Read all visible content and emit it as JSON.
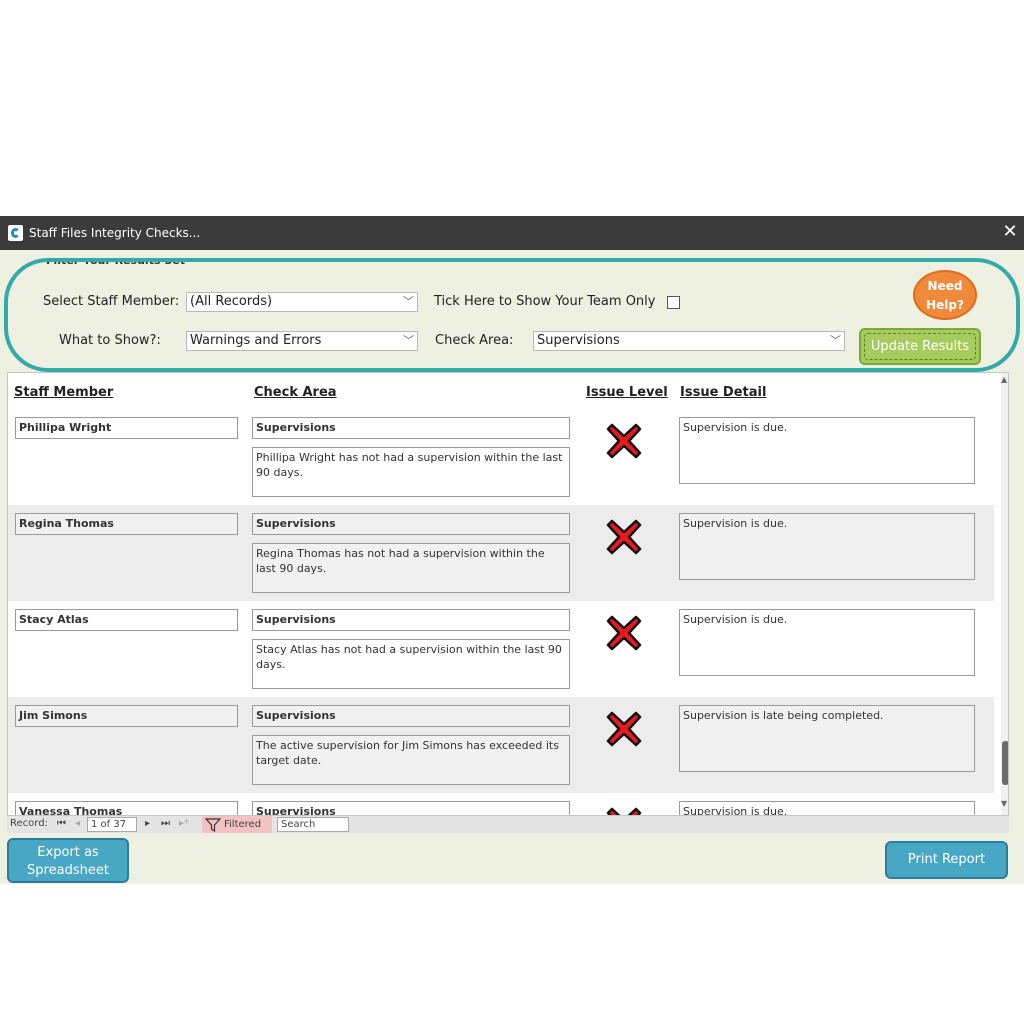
{
  "window": {
    "title": "Staff Files Integrity Checks..."
  },
  "filters": {
    "legend": "Filter Your Results Set",
    "staff_label": "Select Staff Member:",
    "staff_value": "(All Records)",
    "team_label": "Tick Here to Show Your Team Only",
    "team_only_checked": false,
    "show_label": "What to Show?:",
    "show_value": "Warnings and Errors",
    "area_label": "Check Area:",
    "area_value": "Supervisions",
    "help_line1": "Need",
    "help_line2": "Help?",
    "update_label": "Update Results"
  },
  "columns": {
    "staff": "Staff Member",
    "area": "Check Area",
    "level": "Issue Level",
    "detail": "Issue Detail"
  },
  "rows": [
    {
      "staff": "Phillipa Wright",
      "area": "Supervisions",
      "message": "Phillipa Wright has not had a supervision within the last 90 days.",
      "detail": "Supervision is due.",
      "level_icon": "error-x-icon"
    },
    {
      "staff": "Regina Thomas",
      "area": "Supervisions",
      "message": "Regina Thomas has not had a supervision within the last 90 days.",
      "detail": "Supervision is due.",
      "level_icon": "error-x-icon"
    },
    {
      "staff": "Stacy Atlas",
      "area": "Supervisions",
      "message": "Stacy Atlas has not had a supervision within the last 90 days.",
      "detail": "Supervision is due.",
      "level_icon": "error-x-icon"
    },
    {
      "staff": "Jim Simons",
      "area": "Supervisions",
      "message": "The active supervision for Jim Simons has exceeded its target date.",
      "detail": "Supervision is late being completed.",
      "level_icon": "error-x-icon"
    },
    {
      "staff": "Vanessa Thomas",
      "area": "Supervisions",
      "message": "",
      "detail": "Supervision is due.",
      "level_icon": "error-x-icon"
    }
  ],
  "navigation": {
    "record_label": "Record:",
    "position": "1 of 37",
    "filtered_label": "Filtered",
    "search_label": "Search"
  },
  "actions": {
    "export_line1": "Export as",
    "export_line2": "Spreadsheet",
    "print_label": "Print Report"
  },
  "colors": {
    "teal_outline": "#33aaa8",
    "help_orange": "#f08a3a",
    "update_green": "#a6cc5e",
    "button_blue": "#47a7c4",
    "error_red": "#e8191f"
  }
}
